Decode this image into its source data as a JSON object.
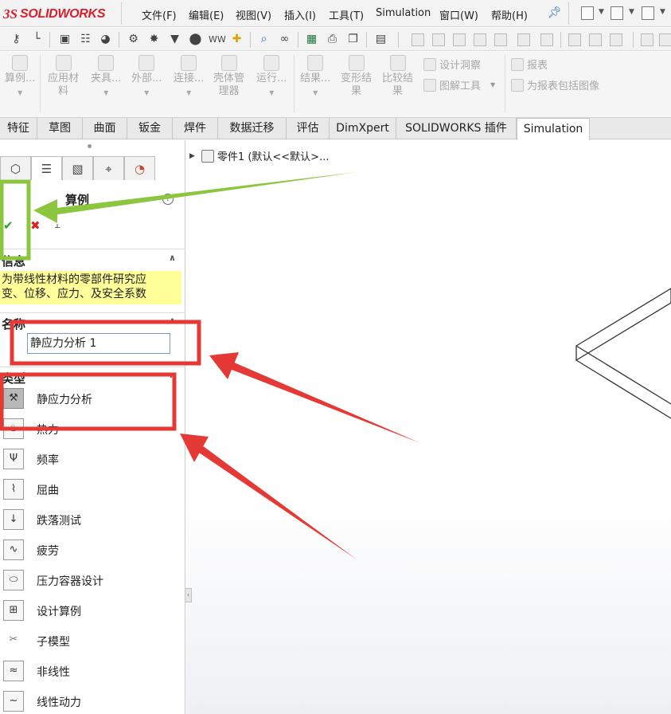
{
  "app": {
    "logo_prefix": "3S",
    "logo_name": "SOLIDWORKS"
  },
  "menu": {
    "items": [
      "文件(F)",
      "编辑(E)",
      "视图(V)",
      "插入(I)",
      "工具(T)",
      "Simulation",
      "窗口(W)",
      "帮助(H)"
    ]
  },
  "commands": {
    "study": "算例...",
    "apply_material_1": "应用材",
    "apply_material_2": "料",
    "fixtures": "夹具...",
    "external_loads": "外部...",
    "connections": "连接...",
    "shell_manager_1": "壳体管",
    "shell_manager_2": "理器",
    "run": "运行...",
    "results_1": "结果...",
    "deformed_1": "变形结",
    "deformed_2": "果",
    "compare_1": "比较结",
    "compare_2": "果",
    "design_insight": "设计洞察",
    "plot_tools": "图解工具",
    "report": "报表",
    "include_image": "为报表包括图像"
  },
  "tabs": [
    "特征",
    "草图",
    "曲面",
    "钣金",
    "焊件",
    "数据迁移",
    "评估",
    "DimXpert",
    "SOLIDWORKS 插件",
    "Simulation"
  ],
  "active_tab": "Simulation",
  "tree": {
    "part_label": "零件1 (默认<<默认>..."
  },
  "property_manager": {
    "title": "算例",
    "help": "?",
    "info_section": "信息",
    "info_text": "为带线性材料的零部件研究应\n变、位移、应力、及安全系数",
    "name_section": "名称",
    "name_value": "静应力分析 1",
    "type_section": "类型",
    "types": [
      {
        "label": "静应力分析",
        "icon": "static-icon"
      },
      {
        "label": "热力",
        "icon": "thermal-icon"
      },
      {
        "label": "频率",
        "icon": "frequency-icon"
      },
      {
        "label": "屈曲",
        "icon": "buckling-icon"
      },
      {
        "label": "跌落测试",
        "icon": "drop-test-icon"
      },
      {
        "label": "疲劳",
        "icon": "fatigue-icon"
      },
      {
        "label": "压力容器设计",
        "icon": "pressure-vessel-icon"
      },
      {
        "label": "设计算例",
        "icon": "design-study-icon"
      },
      {
        "label": "子模型",
        "icon": "submodel-icon"
      },
      {
        "label": "非线性",
        "icon": "nonlinear-icon"
      },
      {
        "label": "线性动力",
        "icon": "linear-dynamic-icon"
      }
    ],
    "selected_type": "静应力分析"
  },
  "colors": {
    "brand_red": "#d8202a",
    "annotation_green": "#8cc63f",
    "annotation_red": "#e53935",
    "info_highlight": "#ffff99"
  }
}
